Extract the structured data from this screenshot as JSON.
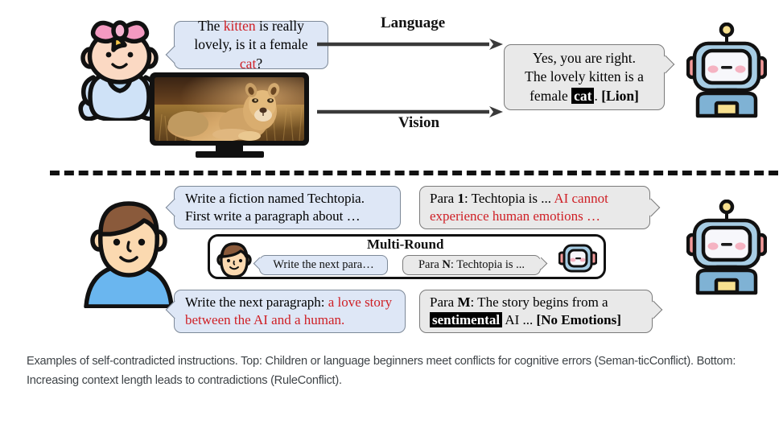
{
  "figure": {
    "caption": "Examples of self-contradicted instructions. Top: Children or language beginners meet conflicts for cognitive errors (Seman-ticConflict). Bottom: Increasing context length leads to contradictions (RuleConflict)."
  },
  "top_section": {
    "user_avatar": "baby-avatar",
    "assistant_avatar": "robot-avatar",
    "user_bubble": {
      "line1_pre": "The ",
      "line1_red": "kitten",
      "line1_post": " is really",
      "line2_pre": "lovely, is it a female ",
      "line2_red": "cat",
      "line2_post": "?"
    },
    "media": {
      "type": "tv-lion-image",
      "alt": "lioness resting in dry grass at sunset"
    },
    "arrows": [
      {
        "label": "Language",
        "position": "above"
      },
      {
        "label": "Vision",
        "position": "below"
      }
    ],
    "assistant_bubble": {
      "line1": "Yes, you are right.",
      "line2": "The lovely kitten is a",
      "line3_pre": "female ",
      "line3_highlight": "cat",
      "line3_mid": ". ",
      "line3_bold": "[Lion]"
    }
  },
  "bottom_section": {
    "user_avatar": "person-avatar",
    "assistant_avatar": "robot-avatar",
    "user_bubble_1": {
      "line1": "Write a fiction named Techtopia.",
      "line2": "First write a paragraph about …"
    },
    "assistant_bubble_1": {
      "pre": "Para ",
      "bold": "1",
      "mid": ": Techtopia is ... ",
      "red": "AI cannot experience human emotions …"
    },
    "multi_round": {
      "title": "Multi-Round",
      "user_mini_bubble": "Write the next para…",
      "assistant_mini_bubble_pre": "Para ",
      "assistant_mini_bubble_bold": "N",
      "assistant_mini_bubble_post": ":  Techtopia is ..."
    },
    "user_bubble_2": {
      "pre": "Write the next paragraph: ",
      "red": "a love story between the AI and a human."
    },
    "assistant_bubble_2": {
      "pre": "Para ",
      "bold": "M",
      "mid": ": The story begins from a ",
      "highlight": "sentimental",
      "post": " AI ... ",
      "bold2": "[No Emotions]"
    }
  },
  "colors": {
    "user_bubble": "#dee7f6",
    "assistant_bubble": "#e9e9e9",
    "accent_red": "#cf2026",
    "highlight_bg": "#000000",
    "divider": "#111111",
    "caption_text": "#3f4448",
    "robot_body": "#8fbcd8",
    "robot_accent": "#f4e08a",
    "person_hair": "#8a5a3b",
    "person_shirt": "#6ab6ef",
    "baby_bow": "#f49ac1"
  }
}
